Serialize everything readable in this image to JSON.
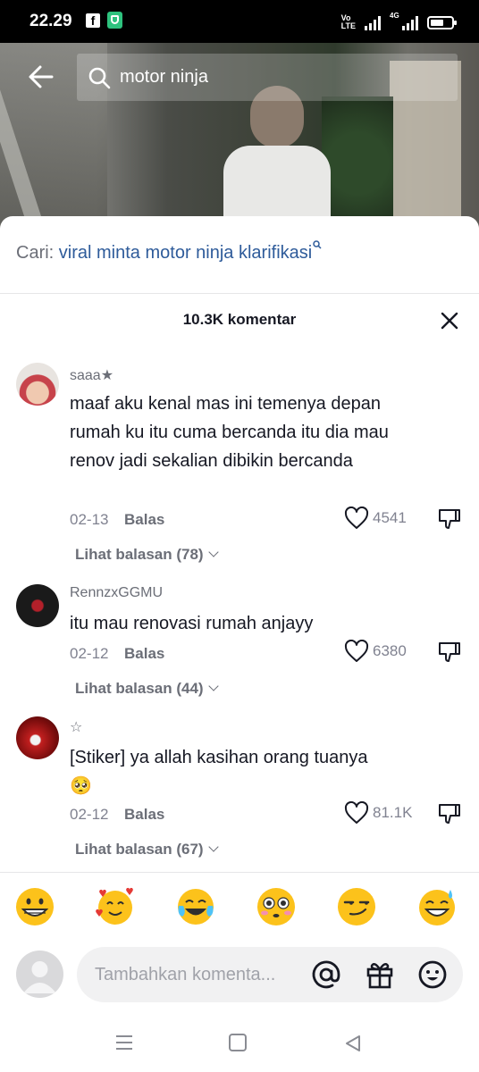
{
  "status_bar": {
    "time": "22.29",
    "fb_glyph": "f",
    "volte_top": "Vo",
    "volte_bottom": "LTE",
    "network_label": "4G",
    "icons": [
      "facebook-icon",
      "shield-icon",
      "volte-icon",
      "signal-icon",
      "4g-signal-icon",
      "battery-icon"
    ]
  },
  "search": {
    "query": "motor ninja",
    "back_icon": "arrow-left-icon",
    "search_icon": "search-icon"
  },
  "related_search": {
    "prefix": "Cari: ",
    "query": "viral minta motor ninja klarifikasi"
  },
  "comments_panel": {
    "header": "10.3K komentar",
    "close_icon": "close-icon"
  },
  "comments": [
    {
      "username": "saaa★",
      "text": "maaf aku kenal mas ini temenya depan rumah ku itu cuma bercanda itu dia mau renov jadi sekalian dibikin bercanda",
      "date": "02-13",
      "reply_label": "Balas",
      "likes": "4541",
      "view_replies": "Lihat balasan (78)"
    },
    {
      "username": "RennzxGGMU",
      "text": "itu mau renovasi rumah anjayy",
      "date": "02-12",
      "reply_label": "Balas",
      "likes": "6380",
      "view_replies": "Lihat balasan (44)"
    },
    {
      "username": "☆",
      "text": "[Stiker] ya allah kasihan orang tuanya",
      "text_emoji": "🥺",
      "date": "02-12",
      "reply_label": "Balas",
      "likes": "81.1K",
      "view_replies": "Lihat balasan (67)"
    }
  ],
  "quick_emojis": [
    "grinning-face",
    "smiling-face-with-hearts",
    "tears-of-joy",
    "flushed-face",
    "smirking-face",
    "sweat-smile"
  ],
  "comment_input": {
    "placeholder": "Tambahkan komenta...",
    "mention_icon": "at-icon",
    "gift_icon": "gift-icon",
    "emoji_icon": "emoji-icon"
  },
  "nav_bar": {
    "icons": [
      "menu-icon",
      "home-square-icon",
      "back-triangle-icon"
    ]
  },
  "colors": {
    "link_blue": "#2e5b9a",
    "secondary_text": "#6b6e77",
    "primary_text": "#161823",
    "input_bg": "#f1f1f2"
  }
}
